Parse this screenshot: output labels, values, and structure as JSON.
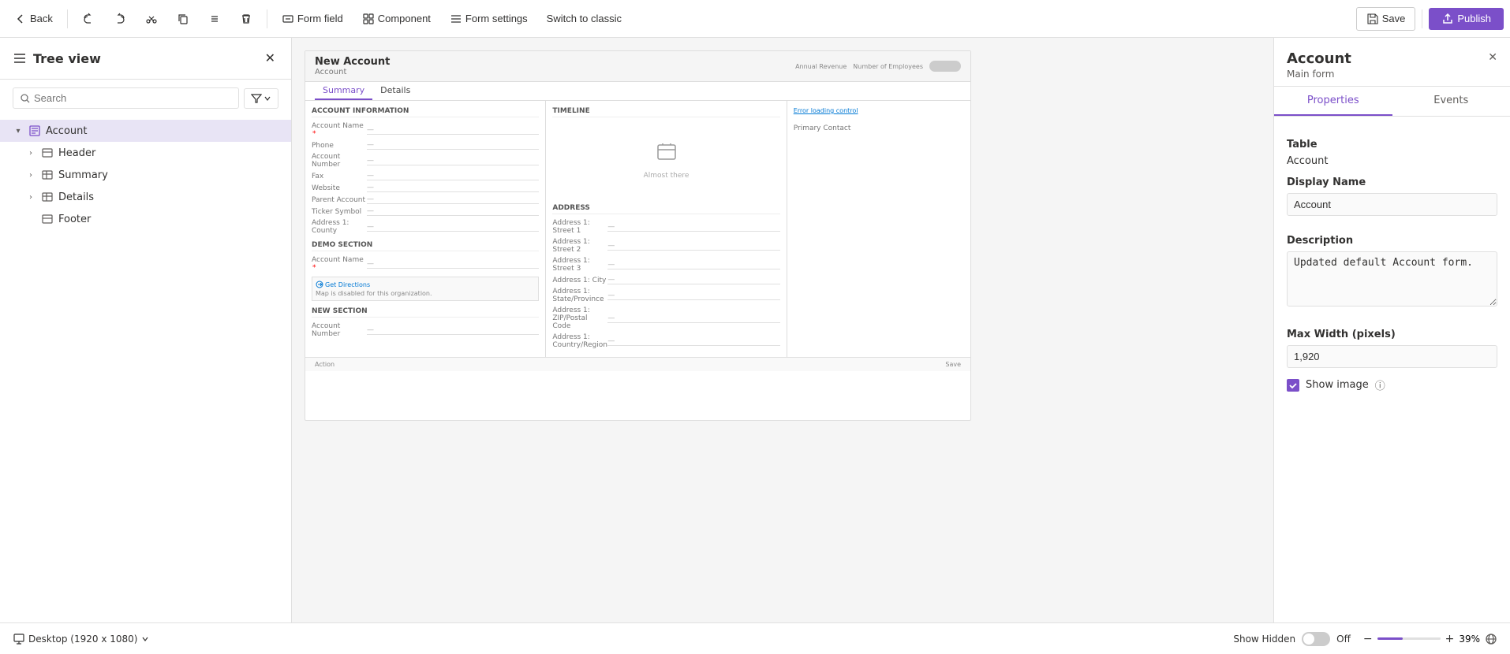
{
  "toolbar": {
    "back_label": "Back",
    "undo_label": "Undo",
    "redo_label": "Redo",
    "cut_label": "Cut",
    "copy_label": "Copy",
    "delete_label": "Delete",
    "more_label": "More",
    "form_field_label": "Form field",
    "component_label": "Component",
    "form_settings_label": "Form settings",
    "switch_label": "Switch to classic",
    "save_label": "Save",
    "publish_label": "Publish"
  },
  "sidebar": {
    "title": "Tree view",
    "search_placeholder": "Search",
    "items": [
      {
        "id": "account",
        "label": "Account",
        "level": 0,
        "expanded": true,
        "selected": true,
        "has_children": true,
        "icon": "form"
      },
      {
        "id": "header",
        "label": "Header",
        "level": 1,
        "expanded": false,
        "selected": false,
        "has_children": true,
        "icon": "section"
      },
      {
        "id": "summary",
        "label": "Summary",
        "level": 1,
        "expanded": false,
        "selected": false,
        "has_children": true,
        "icon": "table"
      },
      {
        "id": "details",
        "label": "Details",
        "level": 1,
        "expanded": false,
        "selected": false,
        "has_children": true,
        "icon": "table"
      },
      {
        "id": "footer",
        "label": "Footer",
        "level": 1,
        "expanded": false,
        "selected": false,
        "has_children": false,
        "icon": "section"
      }
    ]
  },
  "preview": {
    "form_title": "New Account",
    "form_subtitle": "Account",
    "tabs": [
      "Summary",
      "Details"
    ],
    "active_tab": "Summary",
    "account_info_section": "ACCOUNT INFORMATION",
    "fields_left": [
      {
        "label": "Account Name",
        "required": true,
        "value": "—"
      },
      {
        "label": "Phone",
        "required": false,
        "value": "—"
      },
      {
        "label": "Account Number",
        "required": false,
        "value": "—"
      },
      {
        "label": "Fax",
        "required": false,
        "value": "—"
      },
      {
        "label": "Website",
        "required": false,
        "value": "—"
      },
      {
        "label": "Parent Account",
        "required": false,
        "value": "—"
      },
      {
        "label": "Ticker Symbol",
        "required": false,
        "value": "—"
      },
      {
        "label": "Address 1: County",
        "required": false,
        "value": "—"
      }
    ],
    "demo_section": "Demo Section",
    "demo_fields": [
      {
        "label": "Account Name",
        "required": true,
        "value": "—"
      }
    ],
    "map_text": "Map is disabled for this organization.",
    "get_directions_text": "Get Directions",
    "new_section": "New Section",
    "new_section_fields": [
      {
        "label": "Account Number",
        "required": false,
        "value": "—"
      }
    ],
    "timeline_label": "Timeline",
    "almost_there": "Almost there",
    "error_loading": "Error loading control",
    "primary_contact": "Primary Contact",
    "address_section": "ADDRESS",
    "address_fields": [
      {
        "label": "Address 1: Street 1",
        "value": "—"
      },
      {
        "label": "Address 1: Street 2",
        "value": "—"
      },
      {
        "label": "Address 1: Street 3",
        "value": "—"
      },
      {
        "label": "Address 1: City",
        "value": "—"
      },
      {
        "label": "Address 1: State/Province",
        "value": "—"
      },
      {
        "label": "Address 1: ZIP/Postal Code",
        "value": "—"
      },
      {
        "label": "Address 1: Country/Region",
        "value": "—"
      }
    ],
    "annual_revenue": "Annual Revenue",
    "num_employees": "Number of Employees"
  },
  "bottom_bar": {
    "desktop_label": "Desktop (1920 x 1080)",
    "show_hidden_label": "Show Hidden",
    "off_label": "Off",
    "zoom_label": "39%",
    "zoom_value": 39
  },
  "right_panel": {
    "title": "Account",
    "subtitle": "Main form",
    "tabs": [
      "Properties",
      "Events"
    ],
    "active_tab": "Properties",
    "table_label": "Table",
    "table_value": "Account",
    "display_name_label": "Display Name",
    "display_name_value": "Account",
    "description_label": "Description",
    "description_value": "Updated default Account form.",
    "max_width_label": "Max Width (pixels)",
    "max_width_value": "1,920",
    "show_image_label": "Show image",
    "show_image_checked": true
  }
}
